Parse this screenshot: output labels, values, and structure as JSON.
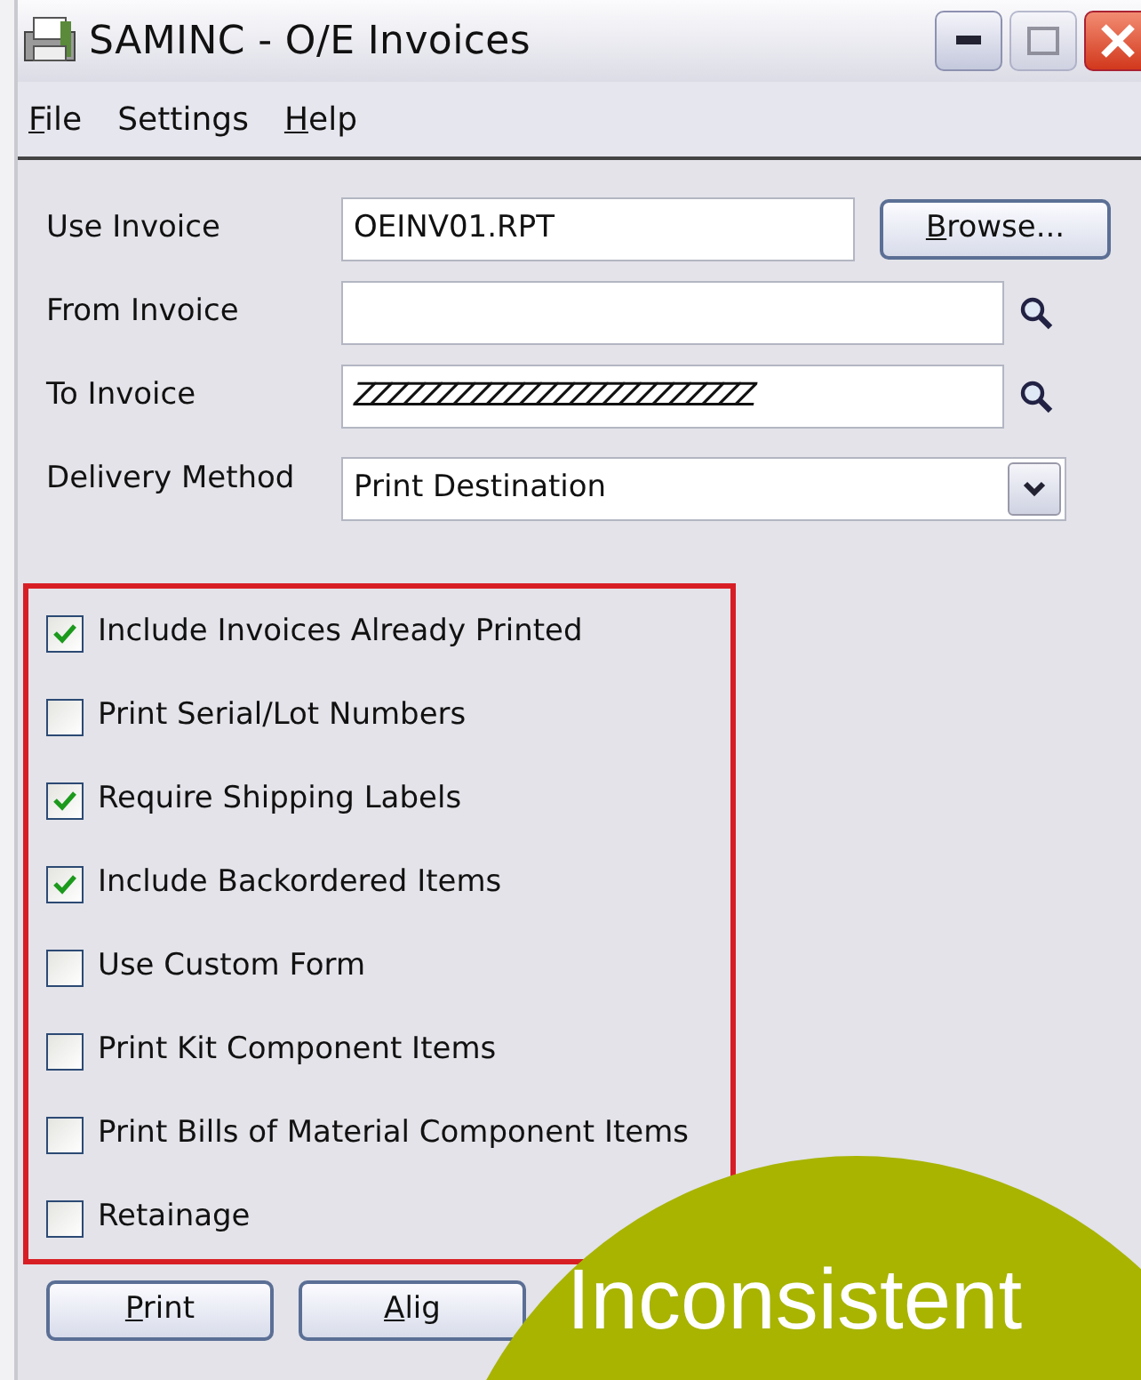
{
  "window": {
    "title": "SAMINC - O/E Invoices"
  },
  "menu": [
    {
      "mnemonic": "F",
      "rest": "ile"
    },
    {
      "rest": "Settings"
    },
    {
      "mnemonic": "H",
      "rest": "elp"
    }
  ],
  "fields": [
    {
      "kind": "browse",
      "label": "Use Invoice",
      "value": "OEINV01.RPT",
      "button": {
        "mnemonic": "B",
        "rest": "rowse..."
      }
    },
    {
      "kind": "lookup",
      "label": "From Invoice"
    },
    {
      "kind": "lookup",
      "label": "To Invoice",
      "value": "ZZZZZZZZZZZZZZZZZZZZZZZZ"
    },
    {
      "kind": "select",
      "label": "Delivery Method",
      "value": "Print Destination"
    }
  ],
  "options": [
    {
      "label": "Include Invoices Already Printed",
      "checked": true
    },
    {
      "label": "Print Serial/Lot Numbers",
      "checked": false
    },
    {
      "label": "Require Shipping Labels",
      "checked": true
    },
    {
      "label": "Include Backordered Items",
      "checked": true
    },
    {
      "label": "Use Custom Form",
      "checked": false
    },
    {
      "label": "Print Kit Component Items",
      "checked": false
    },
    {
      "label": "Print Bills of Material Component Items",
      "checked": false
    },
    {
      "label": "Retainage",
      "checked": false
    }
  ],
  "buttons": [
    {
      "mnemonic": "P",
      "rest": "rint"
    },
    {
      "mnemonic": "A",
      "rest": "lig"
    }
  ],
  "annotation": {
    "text": "Inconsistent"
  }
}
